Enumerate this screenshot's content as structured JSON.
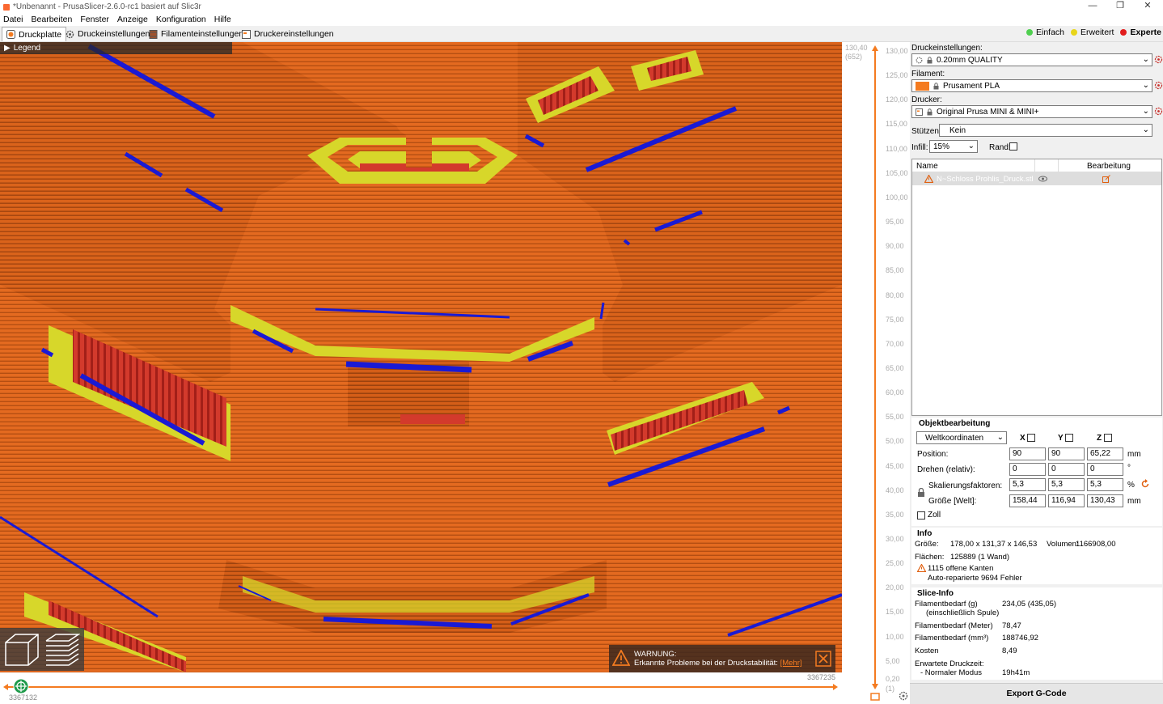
{
  "window": {
    "title": "*Unbenannt - PrusaSlicer-2.6.0-rc1 basiert auf Slic3r",
    "minimize": "—",
    "maximize": "❐",
    "close": "✕"
  },
  "menu": [
    "Datei",
    "Bearbeiten",
    "Fenster",
    "Anzeige",
    "Konfiguration",
    "Hilfe"
  ],
  "tabs": [
    "Druckplatte",
    "Druckeinstellungen",
    "Filamenteinstellungen",
    "Druckereinstellungen"
  ],
  "modes": [
    {
      "label": "Einfach",
      "color": "#4fcf4f"
    },
    {
      "label": "Erweitert",
      "color": "#e8d51a"
    },
    {
      "label": "Experte",
      "color": "#e11d1d"
    }
  ],
  "viewport": {
    "legend": "Legend",
    "warning_title": "WARNUNG:",
    "warning_text": "Erkannte Probleme bei der Druckstabilität:",
    "warning_link": "[Mehr]",
    "colors": {
      "perimeter": "#e46a20",
      "overhang": "#1a1ad4",
      "infill_top": "#d7d72a",
      "solid": "#c8302b"
    }
  },
  "hslider": {
    "left_value": "3367132",
    "right_value": "3367235"
  },
  "vslider": {
    "top_value": "130,40",
    "top_layer": "(652)",
    "bottom_value": "0,20",
    "bottom_layer": "(1)",
    "ticks": [
      "130,00",
      "125,00",
      "120,00",
      "115,00",
      "110,00",
      "105,00",
      "100,00",
      "95,00",
      "90,00",
      "85,00",
      "80,00",
      "75,00",
      "70,00",
      "65,00",
      "60,00",
      "55,00",
      "50,00",
      "45,00",
      "40,00",
      "35,00",
      "30,00",
      "25,00",
      "20,00",
      "15,00",
      "10,00",
      "5,00"
    ]
  },
  "settings": {
    "print_label": "Druckeinstellungen:",
    "print_value": "0.20mm QUALITY",
    "filament_label": "Filament:",
    "filament_value": "Prusament PLA",
    "filament_color": "#f47b20",
    "printer_label": "Drucker:",
    "printer_value": "Original Prusa MINI & MINI+",
    "supports_label": "Stützen:",
    "supports_value": "Kein",
    "infill_label": "Infill:",
    "infill_value": "15%",
    "brim_label": "Rand:"
  },
  "objects": {
    "col_name": "Name",
    "col_edit": "Bearbeitung",
    "rows": [
      {
        "name": "N~Schloss Prohlis_Druck.stl"
      }
    ]
  },
  "object_manip": {
    "title": "Objektbearbeitung",
    "coord_system": "Weltkoordinaten",
    "axis_x": "X",
    "axis_y": "Y",
    "axis_z": "Z",
    "position_label": "Position:",
    "position": [
      "90",
      "90",
      "65,22"
    ],
    "position_unit": "mm",
    "rotate_label": "Drehen (relativ):",
    "rotate": [
      "0",
      "0",
      "0"
    ],
    "rotate_unit": "°",
    "scale_label": "Skalierungsfaktoren:",
    "scale": [
      "5,3",
      "5,3",
      "5,3"
    ],
    "scale_unit": "%",
    "size_label": "Größe [Welt]:",
    "size": [
      "158,44",
      "116,94",
      "130,43"
    ],
    "size_unit": "mm",
    "inch_label": "Zoll"
  },
  "info": {
    "title": "Info",
    "size_label": "Größe:",
    "size_value": "178,00 x 131,37 x 146,53",
    "volume_label": "Volumen:",
    "volume_value": "1166908,00",
    "facets_label": "Flächen:",
    "facets_value": "125889 (1 Wand)",
    "open_edges": "1115 offene Kanten",
    "auto_repaired": "Auto-reparierte 9694 Fehler"
  },
  "slice_info": {
    "title": "Slice-Info",
    "filament_g_label": "Filamentbedarf (g)",
    "filament_g_sub": "(einschließlich Spule)",
    "filament_g_value": "234,05 (435,05)",
    "filament_m_label": "Filamentbedarf (Meter)",
    "filament_m_value": "78,47",
    "filament_mm3_label": "Filamentbedarf (mm³)",
    "filament_mm3_value": "188746,92",
    "cost_label": "Kosten",
    "cost_value": "8,49",
    "time_label": "Erwartete Druckzeit:",
    "mode_label": "- Normaler Modus",
    "mode_value": "19h41m"
  },
  "export_label": "Export G-Code"
}
